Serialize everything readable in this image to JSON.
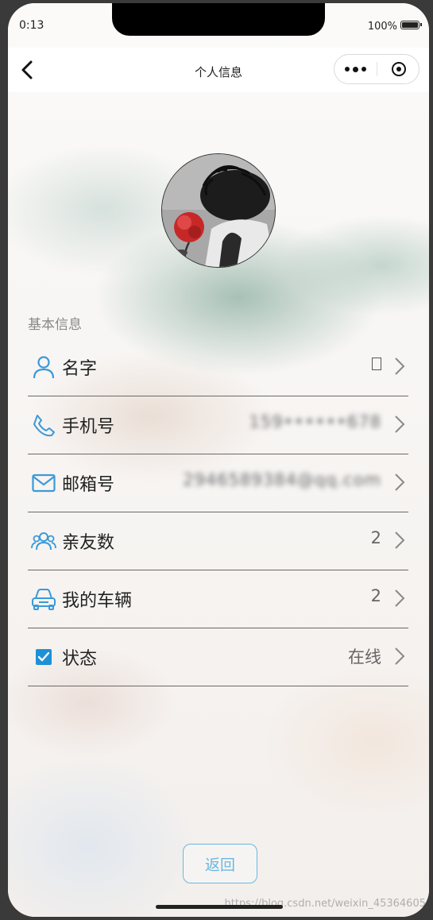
{
  "status_bar": {
    "time": "0:13",
    "battery_percent": "100%"
  },
  "nav": {
    "title": "个人信息"
  },
  "profile": {
    "section_title": "基本信息"
  },
  "rows": [
    {
      "icon": "user-icon",
      "label": "名字",
      "value": ""
    },
    {
      "icon": "phone-icon",
      "label": "手机号",
      "value": "159••••••678"
    },
    {
      "icon": "mail-icon",
      "label": "邮箱号",
      "value": "2946589384@qq.com"
    },
    {
      "icon": "friends-icon",
      "label": "亲友数",
      "value": "2"
    },
    {
      "icon": "car-icon",
      "label": "我的车辆",
      "value": "2"
    },
    {
      "icon": "checkbox-icon",
      "label": "状态",
      "value": "在线"
    }
  ],
  "footer": {
    "return_label": "返回",
    "watermark": "https://blog.csdn.net/weixin_45364605"
  },
  "colors": {
    "accent": "#3a9ad9",
    "button_border": "#6ab7df"
  }
}
